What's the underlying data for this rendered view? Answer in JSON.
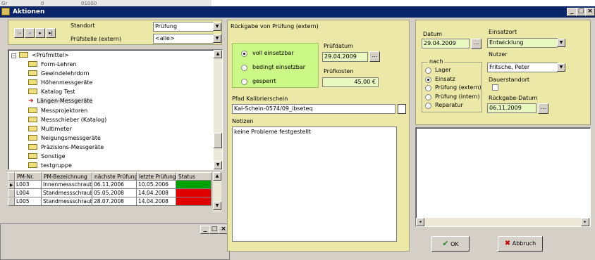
{
  "window": {
    "title": "Aktionen"
  },
  "bg": {
    "strip_left": "Gr",
    "strip_mid": "0",
    "strip_num": "01000"
  },
  "nav": {
    "standort_label": "Standort",
    "standort_value": "Prüfung",
    "pruefstelle_label": "Prüfstelle (extern)",
    "pruefstelle_value": "<alle>"
  },
  "tree": {
    "root": "<Prüfmittel>",
    "items": [
      "Form-Lehren",
      "Gewindelehrdorn",
      "Höhenmessgeräte",
      "Katalog Test",
      "Längen-Messgeräte",
      "Messprojektoren",
      "Messschieber (Katalog)",
      "Multimeter",
      "Neigungsmessgeräte",
      "Präzisions-Messgeräte",
      "Sonstige",
      "testgruppe"
    ]
  },
  "grid": {
    "headers": [
      "PM-Nr.",
      "PM-Bezeichnung",
      "nächste Prüfung",
      "letzte Prüfung",
      "Status"
    ],
    "rows": [
      {
        "nr": "L003",
        "bez": "Innenmessschraube",
        "next": "06.11.2006",
        "last": "10.05.2006",
        "status": "#00a000"
      },
      {
        "nr": "L004",
        "bez": "Standmessschraube",
        "next": "05.05.2008",
        "last": "14.04.2008",
        "status": "#e00000"
      },
      {
        "nr": "L005",
        "bez": "Standmessschraube",
        "next": "28.07.2008",
        "last": "14.04.2008",
        "status": "#e00000"
      }
    ]
  },
  "mid": {
    "title": "Rückgabe von Prüfung (extern)",
    "radios": [
      "voll einsetzbar",
      "bedingt einsetzbar",
      "gesperrt"
    ],
    "pruefdatum_label": "Prüfdatum",
    "pruefdatum": "29.04.2009",
    "dots": "...",
    "kosten_label": "Prüfkosten",
    "kosten": "45,00 €",
    "pfad_label": "Pfad Kalibrierschein",
    "pfad": "Kal-Schein-0574/09_ibseteq",
    "notizen_label": "Notizen",
    "notizen": "keine Probleme festgestellt"
  },
  "right": {
    "datum_label": "Datum",
    "datum": "29.04.2009",
    "einsatzort_label": "Einsatzort",
    "einsatzort": "Entwicklung",
    "nach_label": "nach",
    "nach": [
      "Lager",
      "Einsatz",
      "Prüfung (extern)",
      "Prüfung (intern)",
      "Reparatur"
    ],
    "nutzer_label": "Nutzer",
    "nutzer": "Fritsche, Peter",
    "dauer_label": "Dauerstandort",
    "rueckgabe_label": "Rückgabe-Datum",
    "rueckgabe": "06.11.2009",
    "ok": "OK",
    "abbruch": "Abbruch"
  },
  "colors": {
    "titlebar": "#0a246a",
    "panel": "#ece9a8",
    "green_field": "#e8f8c0",
    "ok_check": "#2a8a2a",
    "cancel_x": "#c00000"
  }
}
